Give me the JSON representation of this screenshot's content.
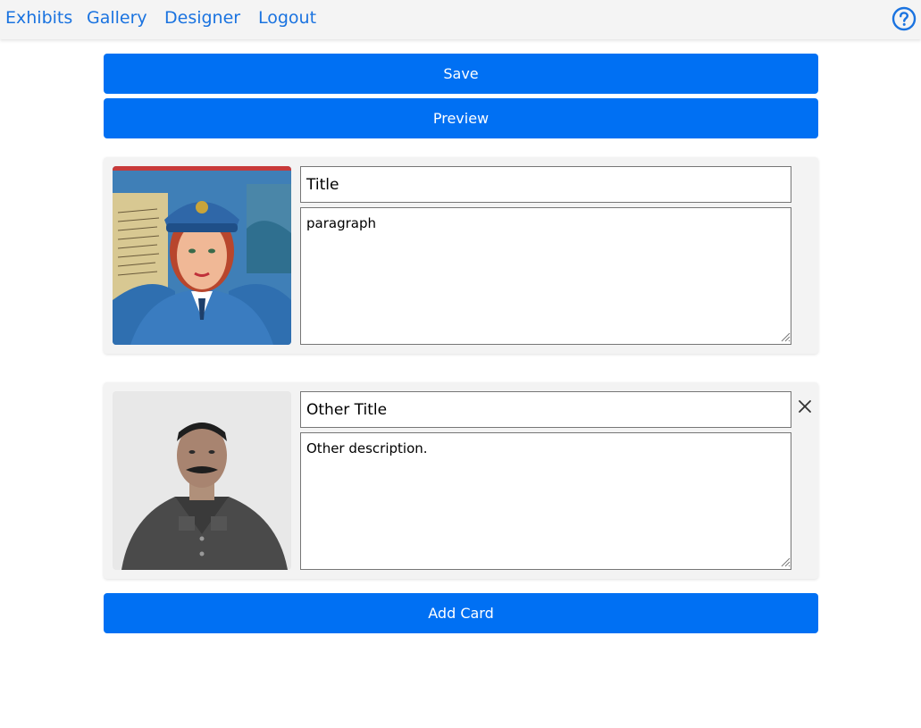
{
  "nav": {
    "items": [
      {
        "label": "Exhibits"
      },
      {
        "label": "Gallery"
      },
      {
        "label": "Designer"
      },
      {
        "label": "Logout"
      }
    ],
    "help_icon": "help-circle-icon"
  },
  "buttons": {
    "save": "Save",
    "preview": "Preview",
    "add_card": "Add Card"
  },
  "cards": [
    {
      "image": "painted portrait of a woman in a blue uniform and cap",
      "title": "Title",
      "description": "paragraph",
      "removable": false
    },
    {
      "image": "black and white photo of a man in a military uniform",
      "title": "Other Title",
      "description": "Other description.",
      "removable": true,
      "remove_icon": "close-icon"
    }
  ],
  "colors": {
    "accent": "#0070f3",
    "link": "#1a73e0",
    "nav_bg": "#f4f4f4",
    "card_bg": "#f3f3f3"
  }
}
